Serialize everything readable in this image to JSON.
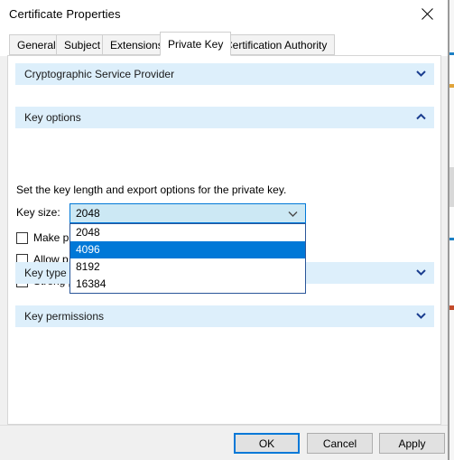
{
  "window": {
    "title": "Certificate Properties",
    "close_icon": "close-icon"
  },
  "tabs": [
    {
      "label": "General",
      "active": false
    },
    {
      "label": "Subject",
      "active": false
    },
    {
      "label": "Extensions",
      "active": false
    },
    {
      "label": "Private Key",
      "active": true
    },
    {
      "label": "Certification Authority",
      "active": false
    }
  ],
  "sections": [
    {
      "name": "csp",
      "title": "Cryptographic Service Provider",
      "expanded": false,
      "chevron": "chevron-down-icon"
    },
    {
      "name": "key-options",
      "title": "Key options",
      "expanded": true,
      "chevron": "chevron-up-icon"
    },
    {
      "name": "key-type",
      "title": "Key type",
      "expanded": false,
      "chevron": "chevron-down-icon"
    },
    {
      "name": "key-permissions",
      "title": "Key permissions",
      "expanded": false,
      "chevron": "chevron-down-icon"
    }
  ],
  "key_options": {
    "description": "Set the key length and export options for the private key.",
    "key_size_label": "Key size:",
    "key_size_value": "2048",
    "dropdown_open": true,
    "dropdown_arrow_icon": "chevron-down-icon",
    "options": [
      {
        "label": "2048",
        "selected": false
      },
      {
        "label": "4096",
        "selected": true
      },
      {
        "label": "8192",
        "selected": false
      },
      {
        "label": "16384",
        "selected": false
      }
    ],
    "checkboxes": [
      {
        "name": "make-private-key-exportable",
        "label": "Make p",
        "checked": false,
        "occluded": true
      },
      {
        "name": "allow-private-key-archival",
        "label": "Allow p",
        "checked": false,
        "occluded": true
      },
      {
        "name": "strong-private-key-protection",
        "label": "Strong private key protection",
        "checked": false,
        "occluded": false
      }
    ]
  },
  "footer": {
    "ok_label": "OK",
    "cancel_label": "Cancel",
    "apply_label": "Apply"
  },
  "colors": {
    "section_header_bg": "#ddeffb",
    "selection_blue": "#0078d7",
    "combo_hover_bg": "#cce8f4",
    "chevron_blue": "#1a3d8f",
    "dialog_bg": "#f0f0f0"
  }
}
